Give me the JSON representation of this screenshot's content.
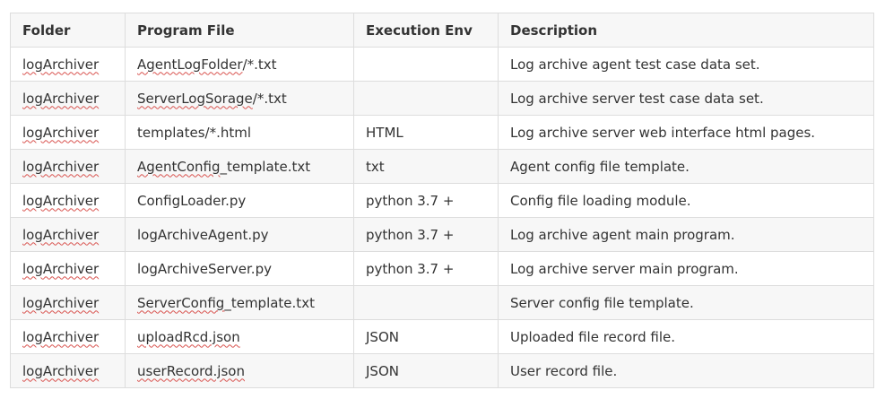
{
  "table": {
    "headers": [
      "Folder",
      "Program File",
      "Execution Env",
      "Description"
    ],
    "rows": [
      {
        "folder": "logArchiver",
        "file_pre": "",
        "file_spell": "AgentLogFolder",
        "file_post": "/*.txt",
        "env": "",
        "desc": "Log archive agent test case data set."
      },
      {
        "folder": "logArchiver",
        "file_pre": "",
        "file_spell": "ServerLogSorage",
        "file_post": "/*.txt",
        "env": "",
        "desc": "Log archive server test case data set."
      },
      {
        "folder": "logArchiver",
        "file_pre": "templates/*.html",
        "file_spell": "",
        "file_post": "",
        "env": "HTML",
        "desc": "Log archive server web interface html pages."
      },
      {
        "folder": "logArchiver",
        "file_pre": "",
        "file_spell": "AgentConfig",
        "file_post": "_template.txt",
        "env": "txt",
        "desc": "Agent config file template."
      },
      {
        "folder": "logArchiver",
        "file_pre": "ConfigLoader.py",
        "file_spell": "",
        "file_post": "",
        "env": "python 3.7 +",
        "desc": "Config file loading module."
      },
      {
        "folder": "logArchiver",
        "file_pre": "logArchiveAgent.py",
        "file_spell": "",
        "file_post": "",
        "env": "python 3.7 +",
        "desc": "Log archive agent main program."
      },
      {
        "folder": "logArchiver",
        "file_pre": "logArchiveServer.py",
        "file_spell": "",
        "file_post": "",
        "env": "python 3.7 +",
        "desc": "Log archive server main program."
      },
      {
        "folder": "logArchiver",
        "file_pre": "",
        "file_spell": "ServerConfig",
        "file_post": "_template.txt",
        "env": "",
        "desc": "Server config file template."
      },
      {
        "folder": "logArchiver",
        "file_pre": "",
        "file_spell": "uploadRcd.json",
        "file_post": "",
        "env": "JSON",
        "desc": "Uploaded file record file."
      },
      {
        "folder": "logArchiver",
        "file_pre": "",
        "file_spell": "userRecord.json",
        "file_post": "",
        "env": "JSON",
        "desc": "User record file."
      }
    ]
  }
}
